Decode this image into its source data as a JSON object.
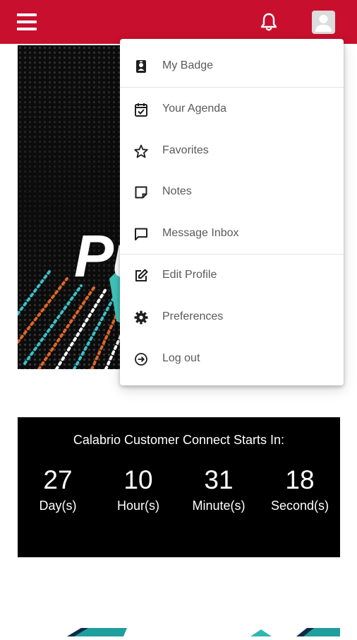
{
  "header": {
    "menu_icon": "hamburger-menu-icon",
    "notification_icon": "bell-icon",
    "avatar_icon": "user-avatar-icon",
    "brand_color": "#c8102e"
  },
  "banner": {
    "visible_text": "Pu"
  },
  "dropdown": {
    "items": [
      {
        "label": "My Badge",
        "icon": "badge-icon"
      },
      {
        "label": "Your Agenda",
        "icon": "calendar-check-icon"
      },
      {
        "label": "Favorites",
        "icon": "star-icon"
      },
      {
        "label": "Notes",
        "icon": "note-icon"
      },
      {
        "label": "Message Inbox",
        "icon": "message-icon"
      },
      {
        "label": "Edit Profile",
        "icon": "edit-icon"
      },
      {
        "label": "Preferences",
        "icon": "gear-icon"
      },
      {
        "label": "Log out",
        "icon": "logout-icon"
      }
    ]
  },
  "countdown": {
    "title": "Calabrio Customer Connect Starts In:",
    "units": [
      {
        "value": "27",
        "label": "Day(s)"
      },
      {
        "value": "10",
        "label": "Hour(s)"
      },
      {
        "value": "31",
        "label": "Minute(s)"
      },
      {
        "value": "18",
        "label": "Second(s)"
      }
    ]
  }
}
